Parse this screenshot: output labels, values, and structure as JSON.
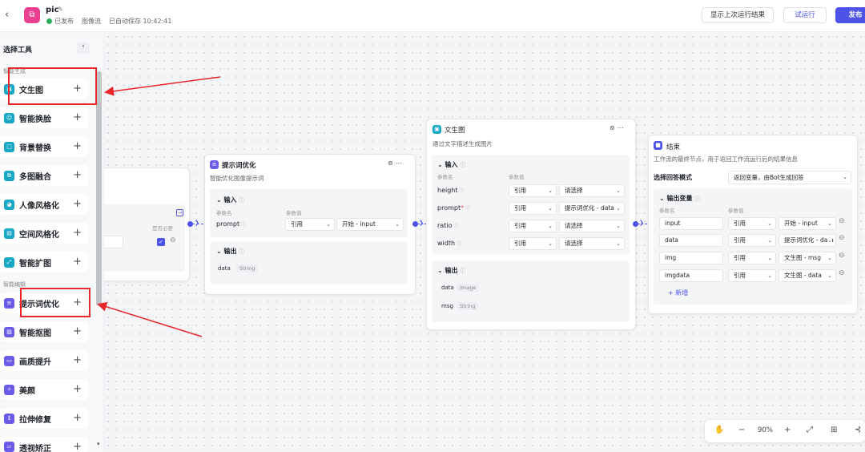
{
  "header": {
    "back_icon": "chevron-left-icon",
    "app_icon": "workflow-icon",
    "title": "pic",
    "status": "已发布",
    "type": "图像流",
    "autosave": "已自动保存 10:42:41",
    "btn_last_result": "显示上次运行结果",
    "btn_try_run": "试运行",
    "btn_publish": "发布"
  },
  "sidebar": {
    "title": "选择工具",
    "section_gen": "智能生成",
    "section_edit": "智能编辑",
    "items": [
      {
        "label": "文生图",
        "icon": "image-gen-icon",
        "color": "#18a8c4"
      },
      {
        "label": "智能换脸",
        "icon": "face-swap-icon",
        "color": "#18a8c4"
      },
      {
        "label": "背景替换",
        "icon": "background-icon",
        "color": "#18a8c4"
      },
      {
        "label": "多图融合",
        "icon": "merge-icon",
        "color": "#18a8c4"
      },
      {
        "label": "人像风格化",
        "icon": "portrait-icon",
        "color": "#18a8c4"
      },
      {
        "label": "空间风格化",
        "icon": "space-icon",
        "color": "#18a8c4"
      },
      {
        "label": "智能扩图",
        "icon": "expand-icon",
        "color": "#18a8c4"
      },
      {
        "label": "提示词优化",
        "icon": "prompt-icon",
        "color": "#6b5ce7"
      },
      {
        "label": "智能抠图",
        "icon": "cutout-icon",
        "color": "#6b5ce7"
      },
      {
        "label": "画质提升",
        "icon": "quality-icon",
        "color": "#6b5ce7"
      },
      {
        "label": "美颜",
        "icon": "beauty-icon",
        "color": "#6b5ce7"
      },
      {
        "label": "拉伸修复",
        "icon": "stretch-icon",
        "color": "#6b5ce7"
      },
      {
        "label": "透视矫正",
        "icon": "perspective-icon",
        "color": "#6b5ce7"
      }
    ],
    "plus": "+"
  },
  "start_node": {
    "required_hdr": "是否必要"
  },
  "prompt_node": {
    "title": "提示词优化",
    "desc": "智能优化图像提示词",
    "input_title": "输入",
    "hdr_name": "参数名",
    "hdr_value": "参数值",
    "param": "prompt",
    "ref": "引用",
    "value": "开始 - input",
    "output_title": "输出",
    "out_name": "data",
    "out_type": "String"
  },
  "text2img_node": {
    "title": "文生图",
    "desc": "通过文字描述生成图片",
    "input_title": "输入",
    "hdr_name": "参数名",
    "hdr_value": "参数值",
    "params": [
      {
        "name": "height",
        "ref": "引用",
        "value": "请选择"
      },
      {
        "name": "prompt",
        "ref": "引用",
        "value": "提示词优化 - data"
      },
      {
        "name": "ratio",
        "ref": "引用",
        "value": "请选择"
      },
      {
        "name": "width",
        "ref": "引用",
        "value": "请选择"
      }
    ],
    "output_title": "输出",
    "outputs": [
      {
        "name": "data",
        "type": "Image"
      },
      {
        "name": "msg",
        "type": "String"
      }
    ]
  },
  "end_node": {
    "title": "结束",
    "desc": "工作流的最终节点，用于返回工作流运行后的结果信息",
    "mode_label": "选择回答模式",
    "mode_value": "返回变量，由Bot生成回答",
    "var_title": "输出变量",
    "hdr_name": "参数名",
    "hdr_value": "参数值",
    "vars": [
      {
        "name": "input",
        "ref": "引用",
        "value": "开始 - input"
      },
      {
        "name": "data",
        "ref": "引用",
        "value": "提示词优化 - data"
      },
      {
        "name": "img",
        "ref": "引用",
        "value": "文生图 - msg"
      },
      {
        "name": "imgdata",
        "ref": "引用",
        "value": "文生图 - data"
      }
    ],
    "add_label": "+ 新增"
  },
  "zoom": {
    "level": "90%",
    "minus": "−",
    "plus": "+"
  }
}
